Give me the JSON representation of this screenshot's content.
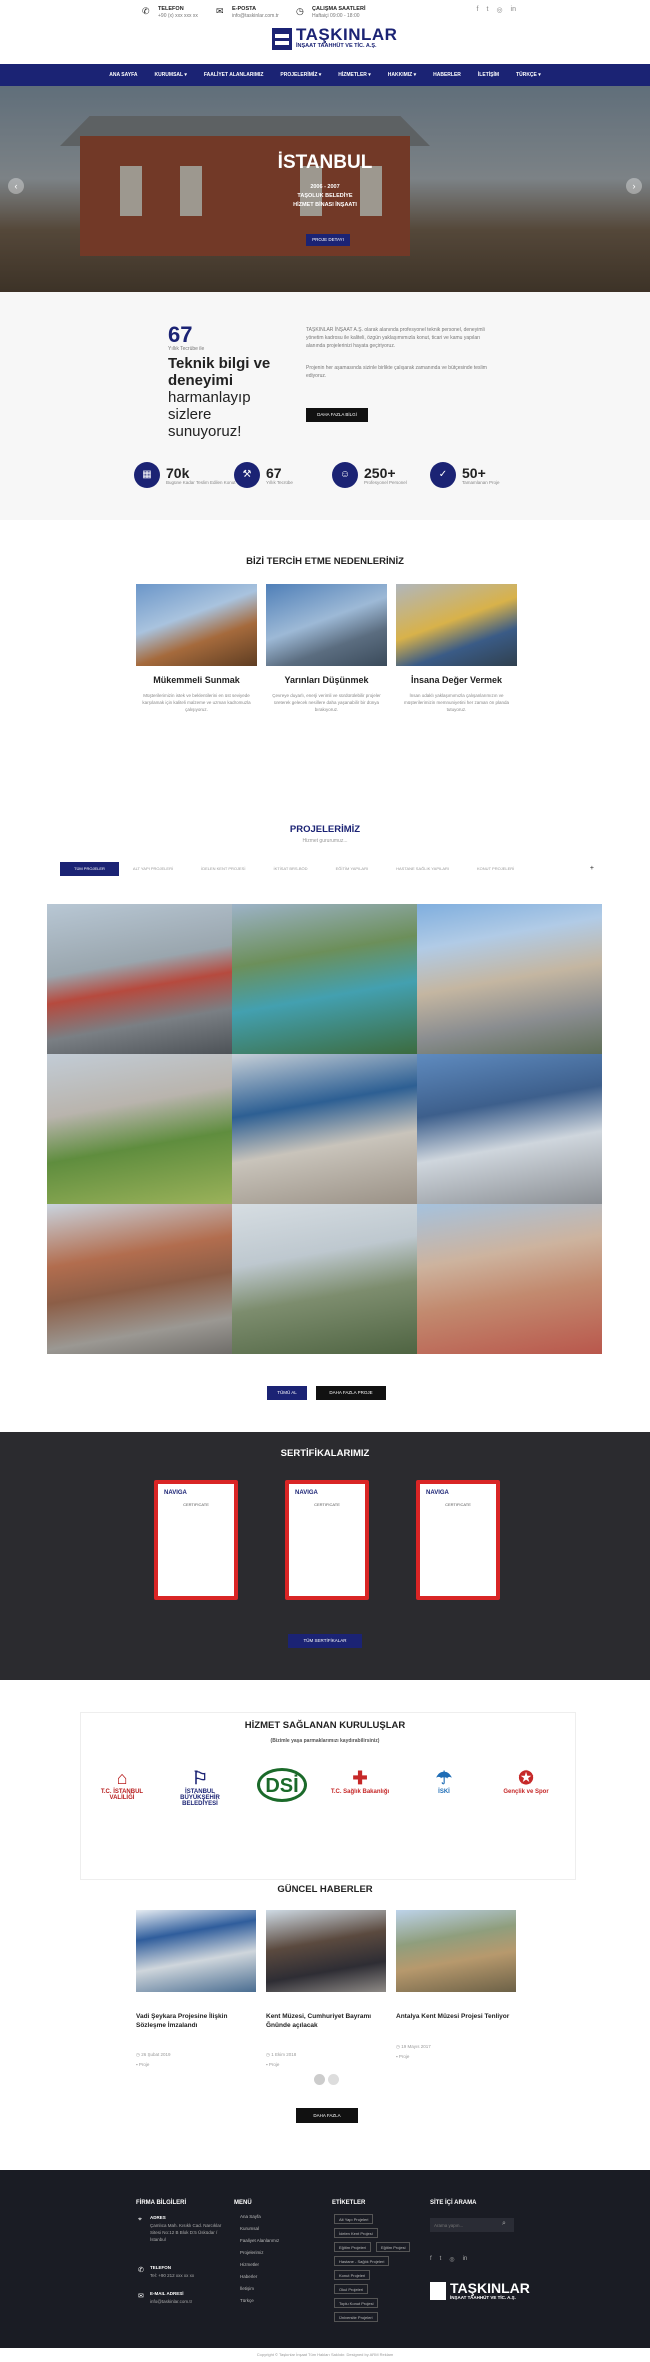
{
  "topbar": {
    "phone_label": "TELEFON",
    "phone_value": "+90 (x) xxx xxx xx",
    "email_label": "E-POSTA",
    "email_value": "info@taskinlar.com.tr",
    "hours_label": "ÇALIŞMA SAATLERİ",
    "hours_value": "Haftaiçi 09:00 - 18:00"
  },
  "logo": {
    "title": "TAŞKINLAR",
    "subtitle": "İNŞAAT TAAHHÜT VE TİC. A.Ş."
  },
  "nav": {
    "items": [
      "ANA SAYFA",
      "KURUMSAL ▾",
      "FAALİYET ALANLARIMIZ",
      "PROJELERİMİZ ▾",
      "HİZMETLER ▾",
      "HAKKIMIZ ▾",
      "HABERLER",
      "İLETİŞİM",
      "TÜRKÇE ▾"
    ]
  },
  "hero": {
    "title": "İSTANBUL",
    "years": "2006 - 2007",
    "line1": "TAŞOLUK BELEDİYE",
    "line2": "HİZMET BİNASI İNŞAATI",
    "button": "PROJE DETAYI",
    "prev": "‹",
    "next": "›"
  },
  "about": {
    "years_num": "67",
    "years_lbl": "Yıllık Tecrübe ile",
    "head1": "Teknik bilgi ve",
    "head2": "deneyimi",
    "head3": "harmanlayıp",
    "head4": "sizlere",
    "head5": "sunuyoruz!",
    "para1": "TAŞKINLAR İNŞAAT A.Ş. olarak alanında profesyonel teknik personel, deneyimli yönetim kadrosu ile kaliteli, özgün yaklaşımımızla konut, ticari ve kamu yapıları alanında projelerinizi hayata geçiriyoruz.",
    "para2": "Projenin her aşamasında sizinle birlikte çalışarak zamanında ve bütçesinde teslim ediyoruz.",
    "button": "DAHA FAZLA BİLGİ",
    "counters": [
      {
        "num": "70k",
        "lbl": "Bugüne Kadar Teslim Edilen Konut",
        "icon": "building-icon"
      },
      {
        "num": "67",
        "lbl": "Yıllık Tecrübe",
        "icon": "hammer-icon"
      },
      {
        "num": "250+",
        "lbl": "Profesyonel Personel",
        "icon": "team-icon"
      },
      {
        "num": "50+",
        "lbl": "Tamamlanan Proje",
        "icon": "check-icon"
      }
    ]
  },
  "why": {
    "title": "BİZİ TERCİH ETME NEDENLERİNİZ",
    "items": [
      {
        "title": "Mükemmeli Sunmak",
        "text": "Müşterilerimizin istek ve beklentilerini en üst seviyede karşılamak için kaliteli malzeme ve uzman kadromuzla çalışıyoruz."
      },
      {
        "title": "Yarınları Düşünmek",
        "text": "Çevreye duyarlı, enerji verimli ve sürdürülebilir projeler üreterek gelecek nesillere daha yaşanabilir bir dünya bırakıyoruz."
      },
      {
        "title": "İnsana Değer Vermek",
        "text": "İnsan odaklı yaklaşımımızla çalışanlarımızın ve müşterilerimizin memnuniyetini her zaman ön planda tutuyoruz."
      }
    ]
  },
  "projects": {
    "title": "PROJELERİMİZ",
    "subtitle": "Hizmet gururumuz...",
    "tabs": [
      "TÜM PROJELER",
      "ALT YAPI PROJELERİ",
      "İDELEN KENT PROJESİ",
      "İKTİSAT BRS-BÖD",
      "EĞİTİM YAPILARI",
      "HASTANE SAĞLIK YAPILARI",
      "KONUT PROJELERİ",
      "+"
    ],
    "btn_all": "TÜMÜ AL",
    "btn_more": "DAHA FAZLA PROJE"
  },
  "certs": {
    "title": "SERTİFİKALARIMIZ",
    "button": "TÜM SERTİFİKALAR",
    "card_brand": "NAVIGA",
    "card_title": "CERTIFICATE"
  },
  "orgs": {
    "title": "HİZMET SAĞLANAN KURULUŞLAR",
    "subtitle": "(Bizimle yaşa parmaklarımızı kaydırabilirsiniz)",
    "items": [
      "T.C. İSTANBUL VALİLİĞİ",
      "İSTANBUL BÜYÜKŞEHİR BELEDİYESİ",
      "DSİ",
      "T.C. Sağlık Bakanlığı",
      "İSKİ",
      "Gençlik ve Spor"
    ]
  },
  "news": {
    "title": "GÜNCEL HABERLER",
    "items": [
      {
        "title": "Vadi Şeykara Projesine İlişkin Sözleşme İmzalandı",
        "date": "26 Şubat 2019",
        "tag": "Proje"
      },
      {
        "title": "Kent Müzesi, Cumhuriyet Bayramı Ğnünde açılacak",
        "date": "1 Ekim 2018",
        "tag": "Proje"
      },
      {
        "title": "Antalya Kent Müzesi Projesi Tenliyor",
        "date": "19 Mayıs 2017",
        "tag": "Proje"
      }
    ],
    "button": "DAHA FAZLA"
  },
  "footer": {
    "col1_title": "FİRMA BİLGİLERİ",
    "addr_label": "ADRES",
    "addr": "Çamlıca Mah. Kısıklı Cad. Narcıklar Sitesi No:12 B Blok D:5 Üsküdar / İstanbul",
    "phone_label": "TELEFON",
    "phone": "Tel: +90 212 xxx xx xx",
    "mail_label": "E-MAIL ADRESİ",
    "mail": "info@taskinlar.com.tr",
    "col2_title": "MENÜ",
    "menu": [
      "Ana Sayfa",
      "Kurumsal",
      "Faaliyet Alanlarımız",
      "Projelerimiz",
      "Hizmetler",
      "Haberler",
      "İletişim",
      "Türkçe"
    ],
    "col3_title": "ETİKETLER",
    "tags": [
      "Alt Yapı Projeleri",
      "İdelen Kent Projesi",
      "Eğitim Projeleri",
      "Eğitim Projesi",
      "Hastane - Sağlık Projeleri",
      "Konut Projeleri",
      "Okul Projeleri",
      "Toplu Konut Projesi",
      "Üniversite Projeleri"
    ],
    "col4_title": "SİTE İÇİ ARAMA",
    "search_placeholder": "Arama yapın...",
    "copyright": "Copyright © Taşkınlar İnşaat Tüm Hakları Saklıdır. Designed by ARM Reklam"
  }
}
